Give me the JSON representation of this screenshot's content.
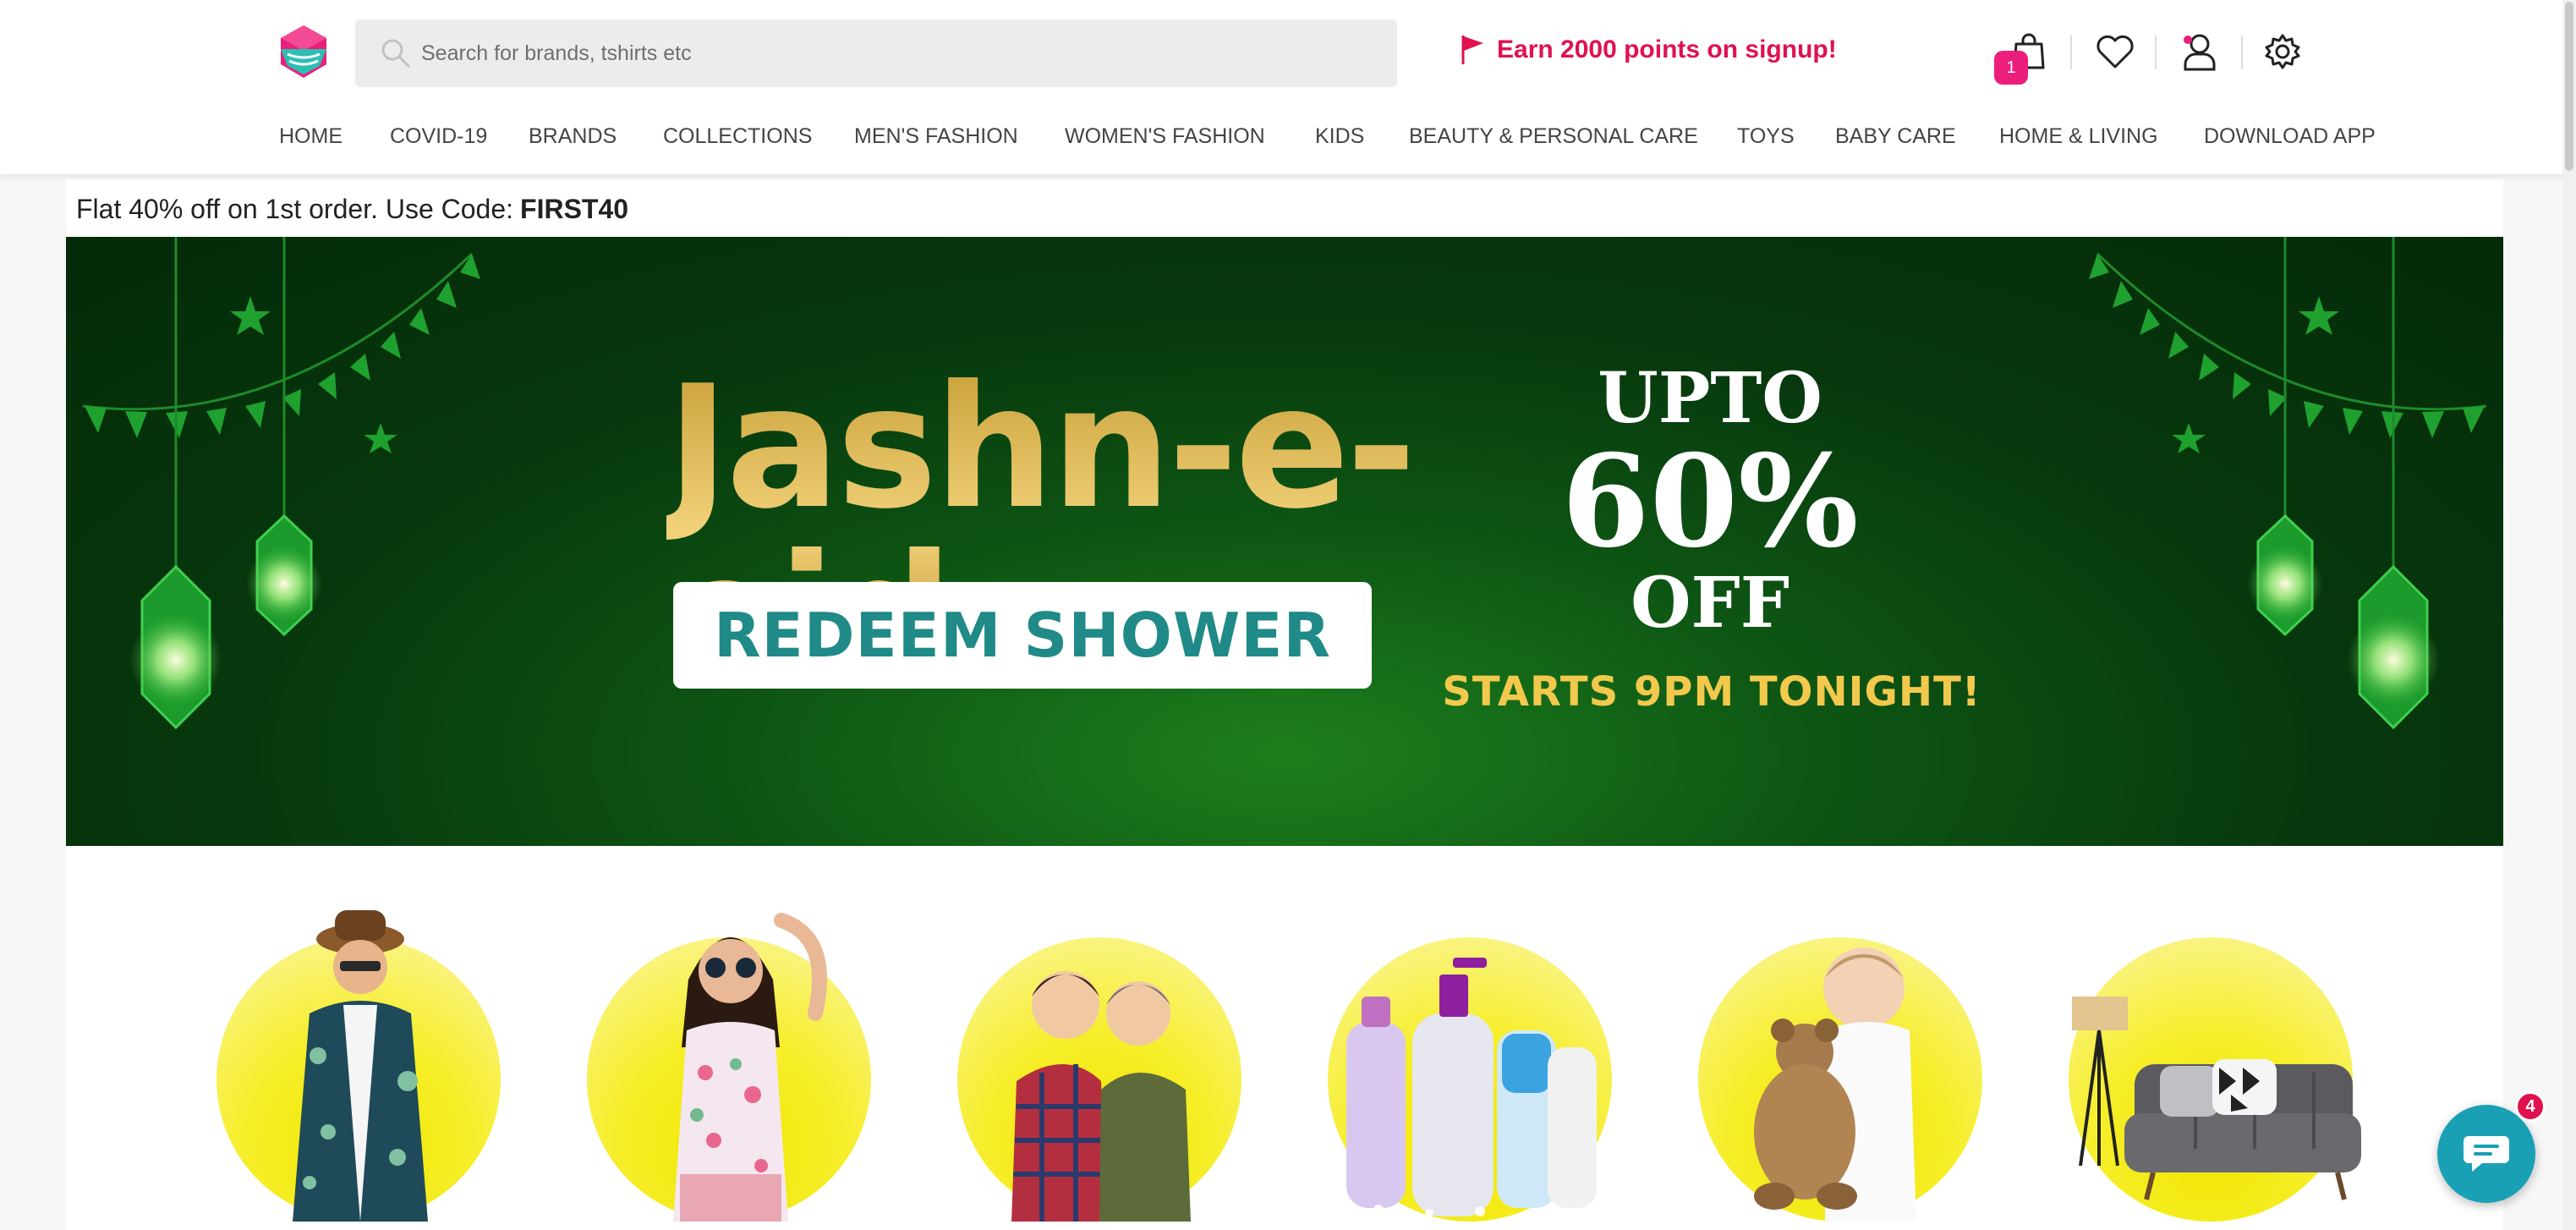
{
  "header": {
    "search": {
      "placeholder": "Search for brands, tshirts etc",
      "icon": "search-icon"
    },
    "promo": {
      "text": "Earn 2000 points on signup!",
      "icon": "flag-icon",
      "color": "#e0114f"
    },
    "cart_count": "1",
    "icons": [
      "shopping-bag-icon",
      "heart-icon",
      "user-icon",
      "gear-icon"
    ]
  },
  "nav": {
    "items": [
      "HOME",
      "COVID-19",
      "BRANDS",
      "COLLECTIONS",
      "MEN'S FASHION",
      "WOMEN'S FASHION",
      "KIDS",
      "BEAUTY & PERSONAL CARE",
      "TOYS",
      "BABY CARE",
      "HOME & LIVING",
      "DOWNLOAD APP"
    ]
  },
  "offer_strip": {
    "text": "Flat 40% off on 1st order. Use Code:",
    "code": "FIRST40"
  },
  "banner": {
    "title": "Jashn-e-eid",
    "subtitle": "REDEEM SHOWER",
    "upto": "UPTO",
    "percent": "60%",
    "off": "OFF",
    "starts": "STARTS 9PM TONIGHT!",
    "colors": {
      "background": "#07380d",
      "gold": "#e0b44a",
      "teal": "#1f8a87",
      "yellow": "#f2c94c"
    }
  },
  "categories": [
    {
      "name": "men"
    },
    {
      "name": "women"
    },
    {
      "name": "kids"
    },
    {
      "name": "beauty"
    },
    {
      "name": "baby-care"
    },
    {
      "name": "home-living"
    }
  ],
  "chat": {
    "badge": "4",
    "icon": "chat-icon",
    "color": "#1aa0b5"
  },
  "brand_colors": {
    "accent": "#ec1e7c",
    "header_bg": "#ffffff"
  }
}
